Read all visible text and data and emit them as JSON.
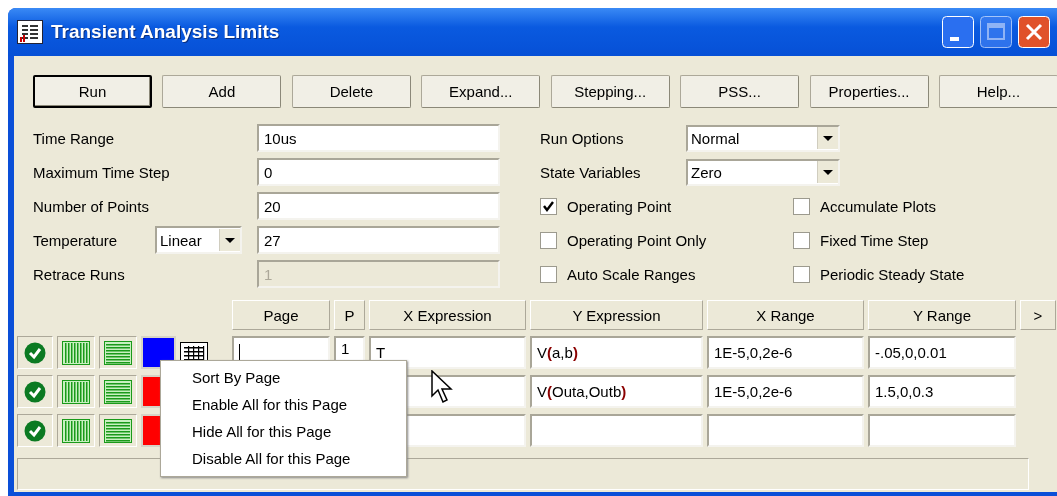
{
  "window": {
    "title": "Transient Analysis Limits"
  },
  "buttons": [
    {
      "label": "Run",
      "default": true
    },
    {
      "label": "Add",
      "default": false
    },
    {
      "label": "Delete",
      "default": false
    },
    {
      "label": "Expand...",
      "default": false
    },
    {
      "label": "Stepping...",
      "default": false
    },
    {
      "label": "PSS...",
      "default": false
    },
    {
      "label": "Properties...",
      "default": false
    },
    {
      "label": "Help...",
      "default": false
    }
  ],
  "fields": [
    {
      "label": "Time Range",
      "value": "10us",
      "disabled": false
    },
    {
      "label": "Maximum Time Step",
      "value": "0",
      "disabled": false
    },
    {
      "label": "Number of Points",
      "value": "20",
      "disabled": false
    },
    {
      "label": "Temperature",
      "mode": "Linear",
      "value": "27",
      "disabled": false
    },
    {
      "label": "Retrace Runs",
      "value": "1",
      "disabled": true
    }
  ],
  "options": [
    {
      "label": "Run Options",
      "value": "Normal"
    },
    {
      "label": "State Variables",
      "value": "Zero"
    }
  ],
  "checkboxes": [
    {
      "label": "Operating Point",
      "checked": true
    },
    {
      "label": "Accumulate Plots",
      "checked": false
    },
    {
      "label": "Operating Point Only",
      "checked": false
    },
    {
      "label": "Fixed Time Step",
      "checked": false
    },
    {
      "label": "Auto Scale Ranges",
      "checked": false
    },
    {
      "label": "Periodic Steady State",
      "checked": false
    }
  ],
  "table": {
    "columns": [
      "Page",
      "P",
      "X Expression",
      "Y Expression",
      "X Range",
      "Y Range"
    ],
    "more_button": ">",
    "rows": [
      {
        "enabled": true,
        "color": "#0000ff",
        "p": "1",
        "x_expression": "T",
        "y_expression": "V**(**a,b**)**",
        "x_range": "1E-5,0,2e-6",
        "y_range": "-.05,0,0.01"
      },
      {
        "enabled": true,
        "color": "#ff0000",
        "y_expression": "V**(**Outa,Outb**)**",
        "x_range": "1E-5,0,2e-6",
        "y_range": "1.5,0,0.3"
      },
      {
        "enabled": true,
        "color": "#ff0000"
      }
    ]
  },
  "context_menu": {
    "items": [
      "Sort By Page",
      "Enable All for this Page",
      "Hide All for this Page",
      "Disable All for this Page"
    ]
  }
}
